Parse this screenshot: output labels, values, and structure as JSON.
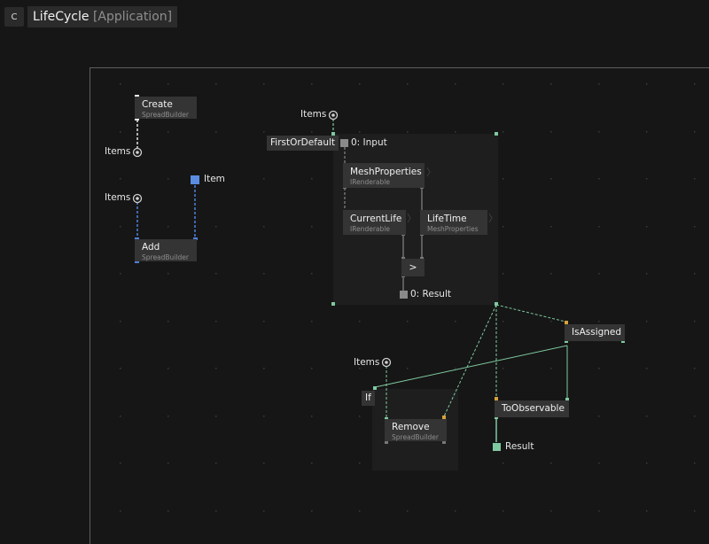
{
  "header": {
    "button_label": "C",
    "title": "LifeCycle",
    "subtitle": "[Application]"
  },
  "nodes": {
    "create": {
      "title": "Create",
      "sub": "SpreadBuilder"
    },
    "add": {
      "title": "Add",
      "sub": "SpreadBuilder"
    },
    "first_or_default": {
      "title": "FirstOrDefault"
    },
    "mesh_properties": {
      "title": "MeshProperties",
      "sub": "IRenderable"
    },
    "current_life": {
      "title": "CurrentLife",
      "sub": "IRenderable"
    },
    "life_time": {
      "title": "LifeTime",
      "sub": "MeshProperties"
    },
    "greater_than": {
      "title": ">"
    },
    "is_assigned": {
      "title": "IsAssigned"
    },
    "if": {
      "title": "If"
    },
    "remove": {
      "title": "Remove",
      "sub": "SpreadBuilder"
    },
    "to_observable": {
      "title": "ToObservable"
    }
  },
  "pins": {
    "items_create": "Items",
    "items_add": "Items",
    "item_add": "Item",
    "items_first": "Items",
    "items_remove": "Items",
    "input_label": "0:  Input",
    "result_inner_label": "0:  Result",
    "result_out_label": "Result"
  },
  "colors": {
    "background": "#161616",
    "node": "#343434",
    "region": "#1e1e1e",
    "link_green": "#7fc9a0",
    "link_blue": "#4f80d8",
    "pin_gray": "#777777",
    "pin_yellow": "#d7a23b",
    "grid_dot": "#3a3a3a"
  }
}
